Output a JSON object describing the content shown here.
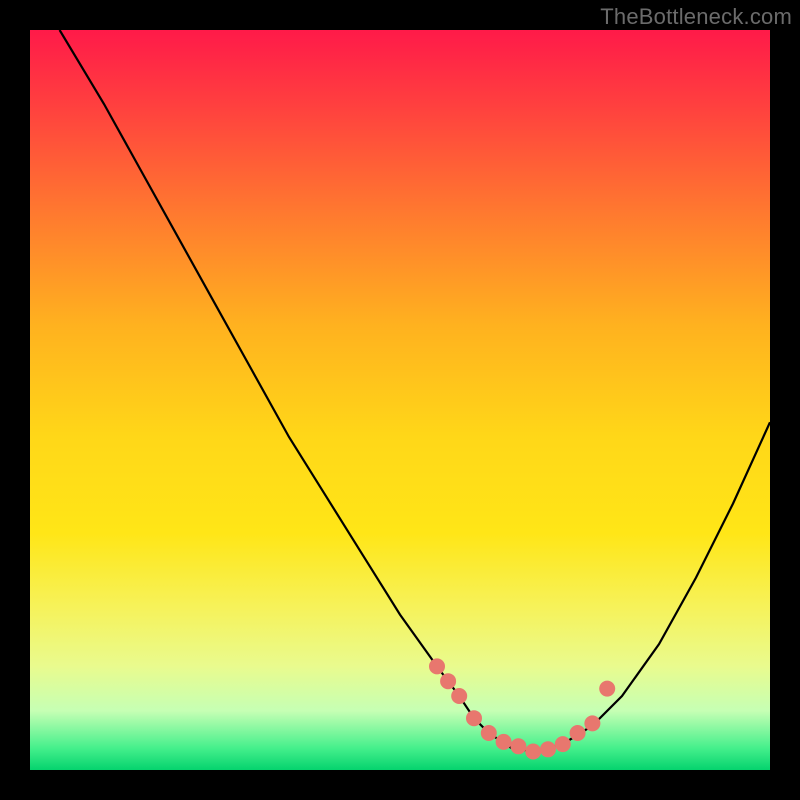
{
  "watermark": "TheBottleneck.com",
  "chart_data": {
    "type": "line",
    "title": "",
    "xlabel": "",
    "ylabel": "",
    "xlim": [
      0,
      100
    ],
    "ylim": [
      0,
      100
    ],
    "series": [
      {
        "name": "curve",
        "x": [
          4,
          10,
          15,
          20,
          25,
          30,
          35,
          40,
          45,
          50,
          55,
          58,
          60,
          62,
          65,
          68,
          72,
          76,
          80,
          85,
          90,
          95,
          100
        ],
        "y": [
          100,
          90,
          81,
          72,
          63,
          54,
          45,
          37,
          29,
          21,
          14,
          10,
          7,
          5,
          3,
          2.5,
          3.5,
          6,
          10,
          17,
          26,
          36,
          47
        ]
      }
    ],
    "markers": {
      "name": "highlighted-points",
      "color": "#e8776e",
      "x": [
        55,
        56.5,
        58,
        60,
        62,
        64,
        66,
        68,
        70,
        72,
        74,
        76,
        78
      ],
      "y": [
        14,
        12,
        10,
        7,
        5,
        3.8,
        3.2,
        2.5,
        2.8,
        3.5,
        5,
        6.3,
        11
      ]
    }
  }
}
